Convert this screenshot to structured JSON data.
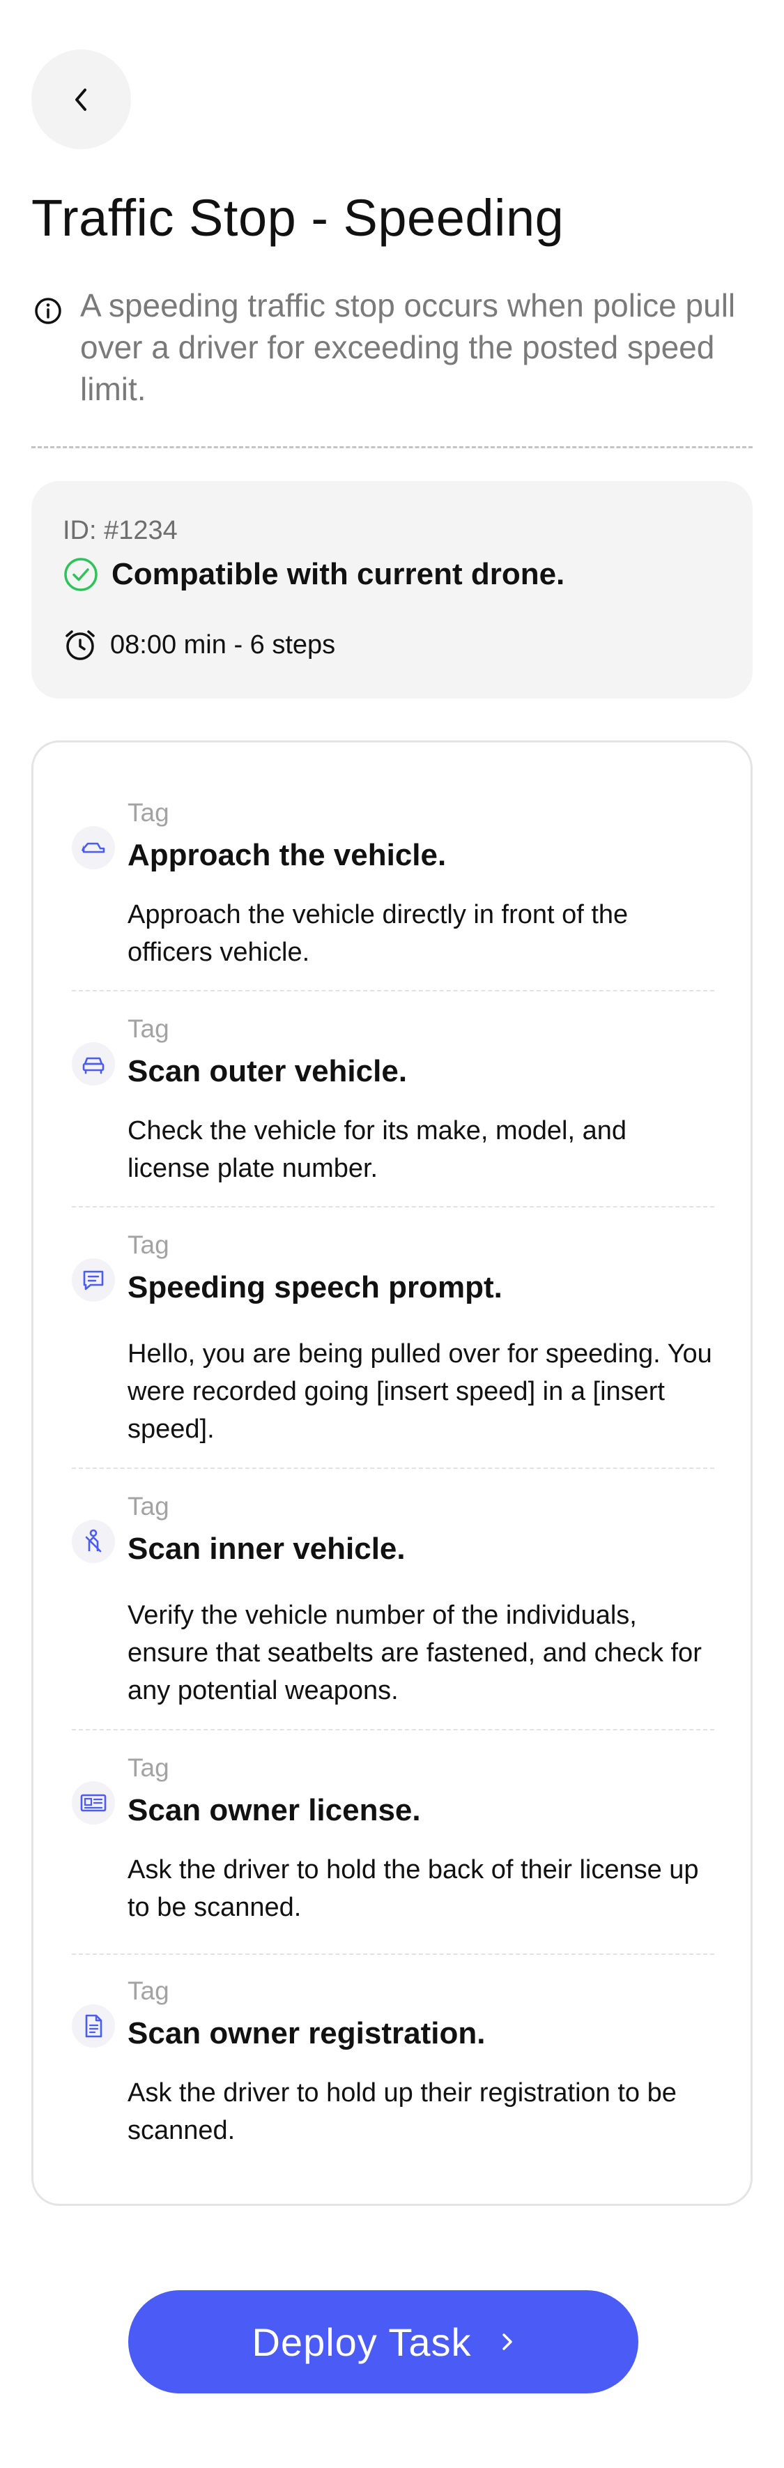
{
  "header": {
    "title": "Traffic Stop - Speeding",
    "description": "A speeding traffic stop occurs when police pull over a driver for exceeding the posted speed limit."
  },
  "info": {
    "id_label": "ID: #1234",
    "compatibility": "Compatible with current drone.",
    "duration": "08:00 min - 6 steps"
  },
  "steps": [
    {
      "icon": "car-side-icon",
      "tag": "Tag",
      "title": "Approach the vehicle.",
      "description": "Approach the vehicle directly in front of the officers vehicle."
    },
    {
      "icon": "car-front-icon",
      "tag": "Tag",
      "title": "Scan outer vehicle.",
      "description": "Check the vehicle for its make, model, and license plate number."
    },
    {
      "icon": "chat-bubble-icon",
      "tag": "Tag",
      "title": "Speeding speech prompt.",
      "description": "Hello, you are being pulled over for speeding. You were recorded going [insert speed] in a [insert speed]."
    },
    {
      "icon": "seatbelt-icon",
      "tag": "Tag",
      "title": "Scan inner vehicle.",
      "description": "Verify the vehicle number of the individuals, ensure that seatbelts are fastened, and check for any potential weapons."
    },
    {
      "icon": "id-card-icon",
      "tag": "Tag",
      "title": "Scan owner license.",
      "description": "Ask the driver to hold the back of their license up to be scanned."
    },
    {
      "icon": "document-icon",
      "tag": "Tag",
      "title": "Scan owner registration.",
      "description": "Ask the driver to hold up their registration to be scanned."
    }
  ],
  "action": {
    "deploy_label": "Deploy Task"
  },
  "colors": {
    "accent": "#4a5cf5",
    "success": "#2ec35a",
    "icon_blue": "#4a5cf5"
  }
}
